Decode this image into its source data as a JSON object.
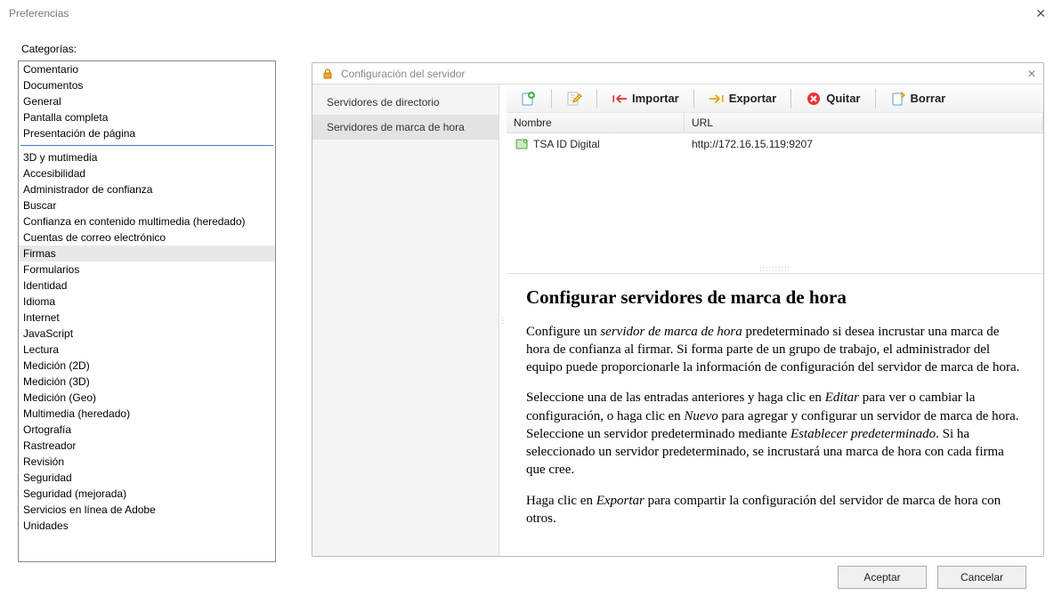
{
  "window": {
    "title": "Preferencias"
  },
  "categories_label": "Categorías:",
  "categories_groupA": [
    "Comentario",
    "Documentos",
    "General",
    "Pantalla completa",
    "Presentación de página"
  ],
  "categories_groupB": [
    "3D y mutimedia",
    "Accesibilidad",
    "Administrador de confianza",
    "Buscar",
    "Confianza en contenido multimedia (heredado)",
    "Cuentas de correo electrónico",
    "Firmas",
    "Formularios",
    "Identidad",
    "Idioma",
    "Internet",
    "JavaScript",
    "Lectura",
    "Medición (2D)",
    "Medición (3D)",
    "Medición (Geo)",
    "Multimedia (heredado)",
    "Ortografía",
    "Rastreador",
    "Revisión",
    "Seguridad",
    "Seguridad (mejorada)",
    "Servicios en línea de Adobe",
    "Unidades"
  ],
  "selected_category": "Firmas",
  "panel": {
    "title": "Configuración del servidor",
    "sub_nav": [
      "Servidores de directorio",
      "Servidores de marca de hora"
    ],
    "sub_nav_selected": 1,
    "toolbar": {
      "importar": "Importar",
      "exportar": "Exportar",
      "quitar": "Quitar",
      "borrar": "Borrar"
    },
    "columns": {
      "name": "Nombre",
      "url": "URL"
    },
    "rows": [
      {
        "name": "TSA ID Digital",
        "url": "http://172.16.15.119:9207"
      }
    ],
    "description": {
      "heading": "Configurar servidores de marca de hora",
      "p1a": "Configure un ",
      "p1_em1": "servidor de marca de hora",
      "p1b": " predeterminado si desea incrustar una marca de hora de confianza al firmar. Si forma parte de un grupo de trabajo, el administrador del equipo puede proporcionarle la información de configuración del servidor de marca de hora.",
      "p2a": "Seleccione una de las entradas anteriores y haga clic en ",
      "p2_em1": "Editar",
      "p2b": " para ver o cambiar la configuración, o haga clic en ",
      "p2_em2": "Nuevo",
      "p2c": " para agregar y configurar un servidor de marca de hora. Seleccione un servidor predeterminado mediante ",
      "p2_em3": "Establecer predeterminado",
      "p2d": ". Si ha seleccionado un servidor predeterminado, se incrustará una marca de hora con cada firma que cree.",
      "p3a": "Haga clic en ",
      "p3_em1": "Exportar",
      "p3b": " para compartir la configuración del servidor de marca de hora con otros."
    }
  },
  "footer": {
    "ok": "Aceptar",
    "cancel": "Cancelar"
  }
}
